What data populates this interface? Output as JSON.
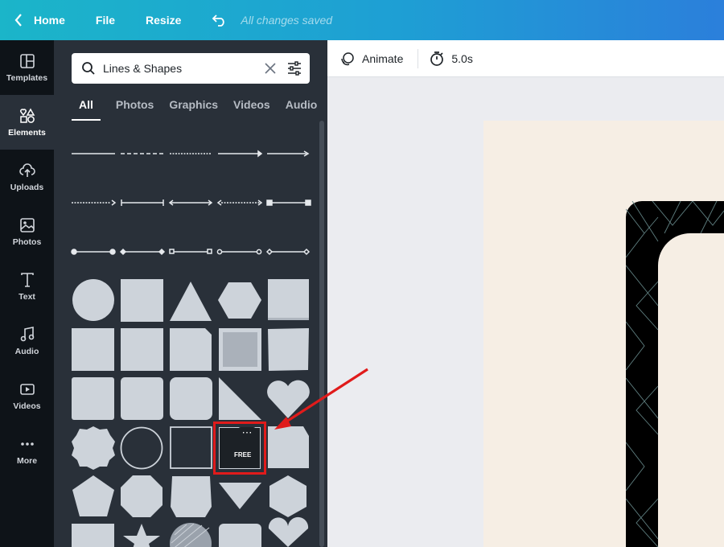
{
  "topbar": {
    "home": "Home",
    "file": "File",
    "resize": "Resize",
    "status": "All changes saved",
    "colors": {
      "gradient_start": "#1bb5c9",
      "gradient_end": "#2b7fdb"
    }
  },
  "rail": {
    "items": [
      {
        "label": "Templates",
        "icon": "templates-icon"
      },
      {
        "label": "Elements",
        "icon": "elements-icon",
        "active": true
      },
      {
        "label": "Uploads",
        "icon": "upload-cloud-icon"
      },
      {
        "label": "Photos",
        "icon": "image-icon"
      },
      {
        "label": "Text",
        "icon": "text-icon"
      },
      {
        "label": "Audio",
        "icon": "music-note-icon"
      },
      {
        "label": "Videos",
        "icon": "video-icon"
      },
      {
        "label": "More",
        "icon": "more-dots-icon"
      }
    ]
  },
  "search": {
    "value": "Lines & Shapes",
    "placeholder": "Search elements"
  },
  "tabs": [
    "All",
    "Photos",
    "Graphics",
    "Videos",
    "Audio"
  ],
  "highlighted_shape": {
    "badge": "FREE",
    "more": "⋯"
  },
  "canvas_toolbar": {
    "animate": "Animate",
    "duration": "5.0s"
  },
  "colors": {
    "panel_bg": "#293039",
    "rail_bg": "#0e1318",
    "shape_fill": "#cdd3da",
    "page_bg": "#f6eee4",
    "highlight": "#e01b1b"
  }
}
